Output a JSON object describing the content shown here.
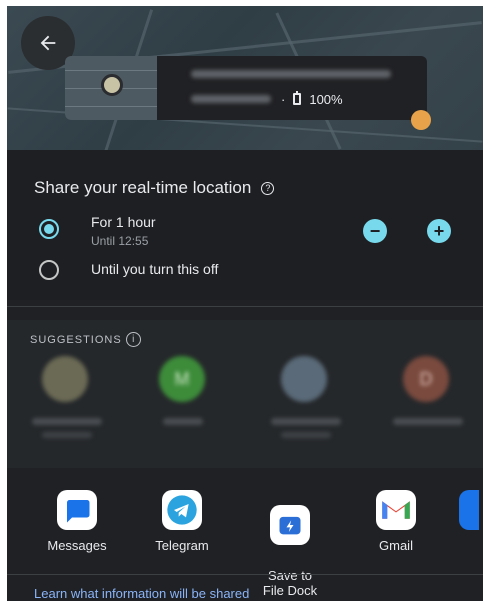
{
  "map": {
    "back_label": "Back",
    "card": {
      "separator": "·",
      "battery": "100%"
    }
  },
  "share": {
    "title": "Share your real-time location",
    "help_glyph": "?",
    "options": [
      {
        "label": "For 1 hour",
        "sub": "Until 12:55",
        "selected": true
      },
      {
        "label": "Until you turn this off",
        "sub": "",
        "selected": false
      }
    ],
    "decrease_glyph": "−",
    "increase_glyph": "+"
  },
  "suggestions": {
    "heading": "SUGGESTIONS",
    "info_glyph": "i",
    "contacts": [
      {
        "initial": "",
        "color": "#6b6a55"
      },
      {
        "initial": "M",
        "color": "#3d8c3a"
      },
      {
        "initial": "",
        "color": "#5a6a78"
      },
      {
        "initial": "D",
        "color": "#7a4a3e"
      }
    ]
  },
  "apps": [
    {
      "label": "Messages",
      "icon": "messages-icon",
      "color": "#1a73e8"
    },
    {
      "label": "Telegram",
      "icon": "telegram-icon",
      "color": "#2aa3df"
    },
    {
      "label": "Save to\nFile Dock",
      "icon": "file-dock-icon",
      "color": "#2b6fd6"
    },
    {
      "label": "Gmail",
      "icon": "gmail-icon",
      "color": "#ffffff"
    }
  ],
  "footer": {
    "learn_link": "Learn what information will be shared"
  },
  "colors": {
    "accent": "#78d9ec",
    "link": "#8ab4f8",
    "sheet_bg": "#202124"
  }
}
